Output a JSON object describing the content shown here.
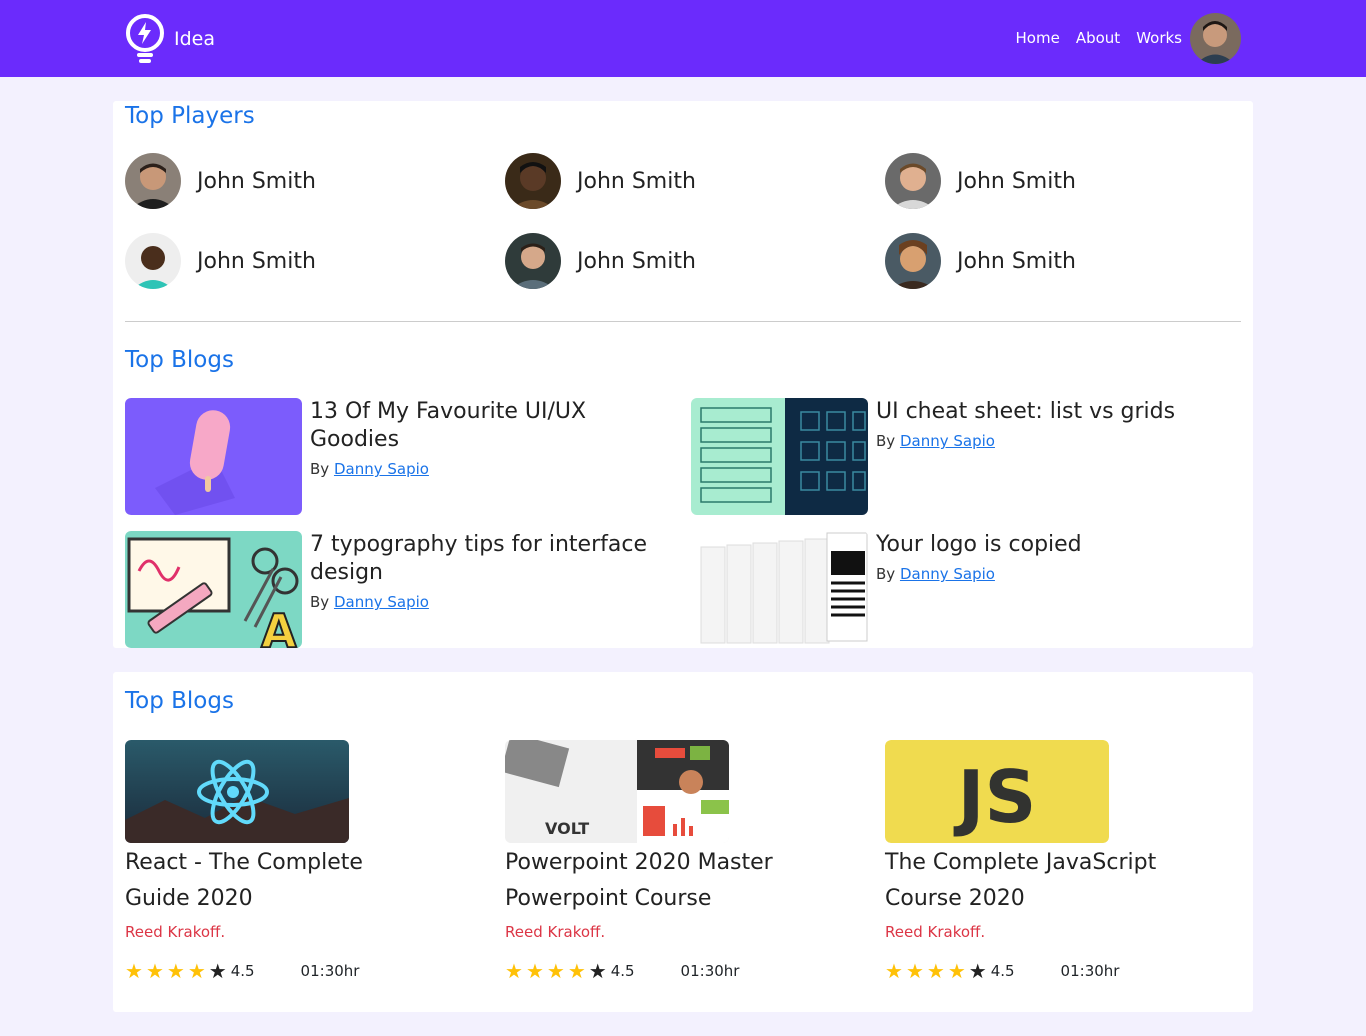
{
  "navbar": {
    "brand": "Idea",
    "links": [
      "Home",
      "About",
      "Works"
    ]
  },
  "top_players": {
    "title": "Top Players",
    "players": [
      {
        "name": "John Smith"
      },
      {
        "name": "John Smith"
      },
      {
        "name": "John Smith"
      },
      {
        "name": "John Smith"
      },
      {
        "name": "John Smith"
      },
      {
        "name": "John Smith"
      }
    ]
  },
  "top_blogs": {
    "title": "Top Blogs",
    "items": [
      {
        "title": "13 Of My Favourite UI/UX Goodies",
        "by": "By",
        "author": "Danny Sapio"
      },
      {
        "title": "UI cheat sheet: list vs grids",
        "by": "By",
        "author": "Danny Sapio"
      },
      {
        "title": "7 typography tips for interface design",
        "by": "By",
        "author": "Danny Sapio"
      },
      {
        "title": "Your logo is copied",
        "by": "By",
        "author": "Danny Sapio"
      }
    ]
  },
  "courses": {
    "title": "Top Blogs",
    "items": [
      {
        "title": "React - The Complete Guide 2020",
        "author": "Reed Krakoff.",
        "rating": "4.5",
        "rating_value": 4.5,
        "duration": "01:30hr",
        "thumb_text": ""
      },
      {
        "title": "Powerpoint 2020 Master Powerpoint Course",
        "author": "Reed Krakoff.",
        "rating": "4.5",
        "rating_value": 4.5,
        "duration": "01:30hr",
        "thumb_text": "VOLT"
      },
      {
        "title": "The Complete JavaScript Course 2020",
        "author": "Reed Krakoff.",
        "rating": "4.5",
        "rating_value": 4.5,
        "duration": "01:30hr",
        "thumb_text": "JS"
      }
    ]
  },
  "colors": {
    "navbar": "#6b2bfc",
    "background": "#f3f1fe",
    "title_blue": "#1a73e8",
    "author_red": "#dc3545",
    "star_gold": "#ffc107"
  }
}
